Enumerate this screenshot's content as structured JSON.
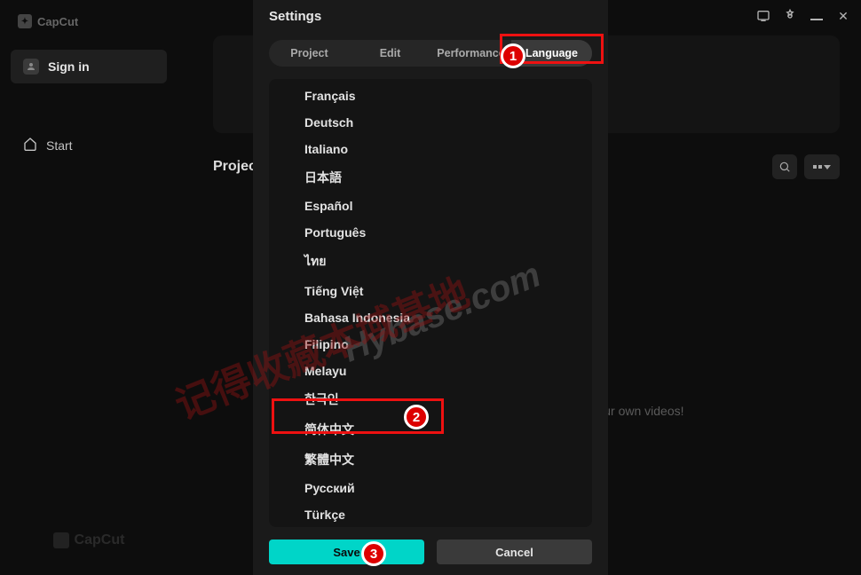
{
  "app": {
    "name": "CapCut"
  },
  "window": {
    "minimize_title": "Minimize",
    "close_title": "Close"
  },
  "sidebar": {
    "signin_label": "Sign in",
    "start_label": "Start",
    "brand_bottom": "CapCut"
  },
  "main": {
    "projects_title": "Projects",
    "empty_hint_suffix": "ng your own videos!"
  },
  "settings": {
    "title": "Settings",
    "tabs": {
      "project": "Project",
      "edit": "Edit",
      "performance": "Performance",
      "language": "Language"
    },
    "languages": [
      "Français",
      "Deutsch",
      "Italiano",
      "日本語",
      "Español",
      "Português",
      "ไทย",
      "Tiếng Việt",
      "Bahasa Indonesia",
      "Filipino",
      "Melayu",
      "한국인",
      "简体中文",
      "繁體中文",
      "Русский",
      "Türkçe"
    ],
    "selected_language_index": 12,
    "save_label": "Save",
    "cancel_label": "Cancel"
  },
  "annotations": {
    "badge1": "1",
    "badge2": "2",
    "badge3": "3",
    "watermark_cn": "记得收藏本域基地",
    "watermark_en": "Hybase.com"
  }
}
